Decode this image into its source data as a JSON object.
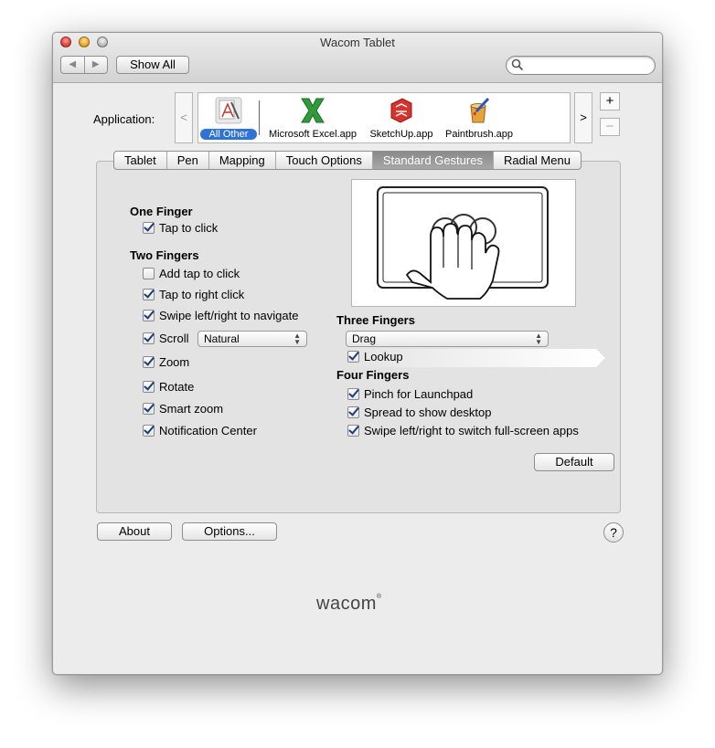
{
  "window": {
    "title": "Wacom Tablet"
  },
  "toolbar": {
    "back_label": "◀",
    "forward_label": "▶",
    "show_all_label": "Show All",
    "search_placeholder": ""
  },
  "application": {
    "label": "Application:",
    "left_arrow": "<",
    "right_arrow": ">",
    "add_label": "+",
    "remove_label": "−",
    "apps": [
      {
        "name": "All Other",
        "icon": "all-other-icon",
        "selected": true
      },
      {
        "name": "Microsoft Excel.app",
        "icon": "excel-icon",
        "selected": false
      },
      {
        "name": "SketchUp.app",
        "icon": "sketchup-icon",
        "selected": false
      },
      {
        "name": "Paintbrush.app",
        "icon": "paintbrush-icon",
        "selected": false
      }
    ]
  },
  "tabs": [
    {
      "label": "Tablet",
      "active": false
    },
    {
      "label": "Pen",
      "active": false
    },
    {
      "label": "Mapping",
      "active": false
    },
    {
      "label": "Touch Options",
      "active": false
    },
    {
      "label": "Standard Gestures",
      "active": true
    },
    {
      "label": "Radial Menu",
      "active": false
    }
  ],
  "gestures": {
    "one_finger": {
      "heading": "One Finger",
      "tap_to_click": {
        "label": "Tap to click",
        "checked": true
      }
    },
    "two_fingers": {
      "heading": "Two Fingers",
      "add_tap_to_click": {
        "label": "Add tap to click",
        "checked": false
      },
      "tap_to_right_click": {
        "label": "Tap to right click",
        "checked": true
      },
      "swipe_navigate": {
        "label": "Swipe left/right to navigate",
        "checked": true
      },
      "scroll": {
        "label": "Scroll",
        "checked": true,
        "mode": "Natural"
      },
      "zoom": {
        "label": "Zoom",
        "checked": true
      },
      "rotate": {
        "label": "Rotate",
        "checked": true
      },
      "smart_zoom": {
        "label": "Smart zoom",
        "checked": true
      },
      "notification_center": {
        "label": "Notification Center",
        "checked": true
      }
    },
    "three_fingers": {
      "heading": "Three Fingers",
      "action": "Drag",
      "lookup": {
        "label": "Lookup",
        "checked": true
      }
    },
    "four_fingers": {
      "heading": "Four Fingers",
      "pinch_launchpad": {
        "label": "Pinch for Launchpad",
        "checked": true
      },
      "spread_desktop": {
        "label": "Spread to show desktop",
        "checked": true
      },
      "swipe_fullscreen": {
        "label": "Swipe left/right to switch full-screen apps",
        "checked": true
      }
    },
    "default_label": "Default"
  },
  "footer": {
    "about_label": "About",
    "options_label": "Options...",
    "help_label": "?",
    "brand": "wacom",
    "brand_mark": "®"
  }
}
